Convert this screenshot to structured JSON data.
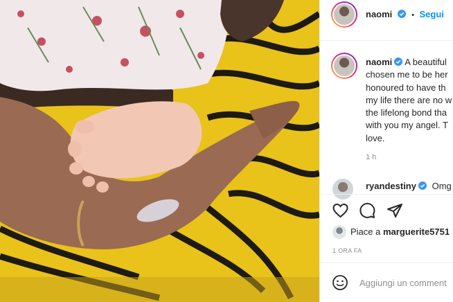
{
  "post": {
    "username": "naomi",
    "separator": "•",
    "follow_label": "Segui",
    "caption_lines": [
      "A beautiful",
      "chosen me to be her",
      "honoured to have th",
      "my life there are no w",
      "the lifelong bond tha",
      "with you my angel. T",
      "love."
    ],
    "caption_age": "1 h"
  },
  "comment": {
    "username": "ryandestiny",
    "text": "Omg"
  },
  "likes": {
    "prefix": "Piace a",
    "user": "marguerite5751"
  },
  "posted_time": "1 ORA FA",
  "add_comment": {
    "placeholder": "Aggiungi un comment"
  },
  "colors": {
    "accent": "#0095f6",
    "verified": "#3897f0",
    "photo_yellow": "#e9c21a"
  },
  "icons": [
    "verified-badge-icon",
    "heart-icon",
    "comment-icon",
    "share-icon",
    "emoji-icon"
  ]
}
